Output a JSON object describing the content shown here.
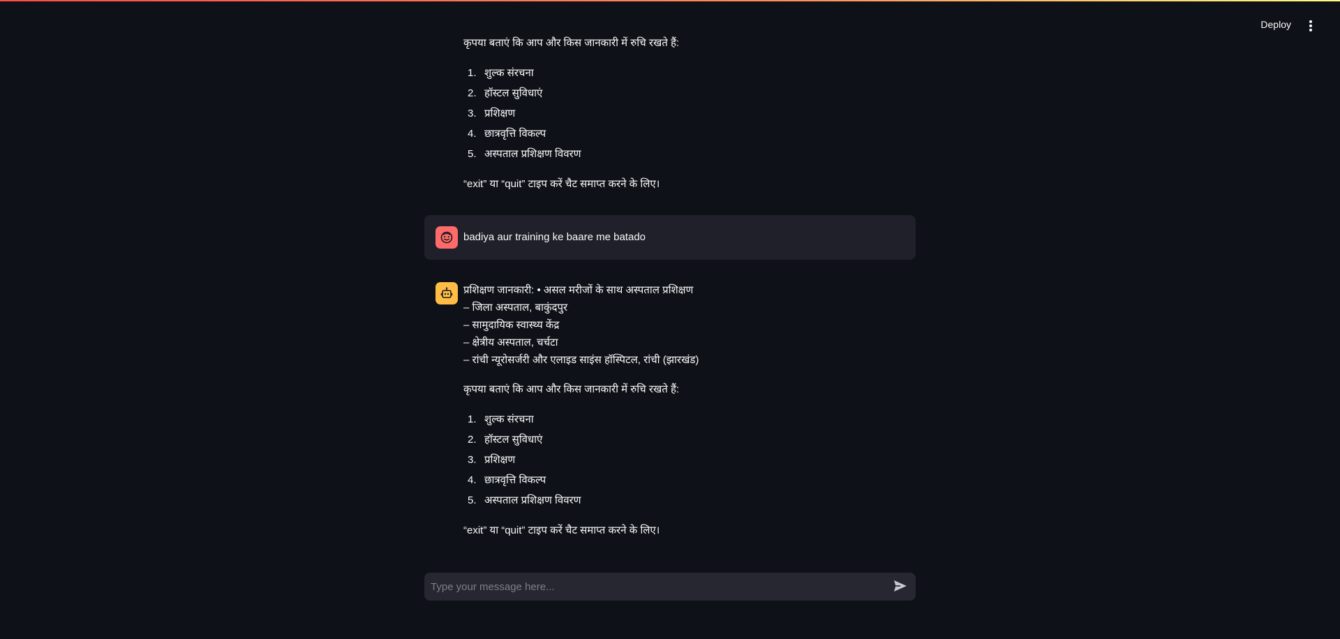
{
  "header": {
    "deploy_label": "Deploy",
    "menu_icon": "more-vertical-icon"
  },
  "messages": {
    "bot_prev": {
      "avatar_icon": "robot-icon",
      "prompt": "कृपया बताएं कि आप और किस जानकारी में रुचि रखते हैं:",
      "options": [
        "शुल्क संरचना",
        "हॉस्टल सुविधाएं",
        "प्रशिक्षण",
        "छात्रवृत्ति विकल्प",
        "अस्पताल प्रशिक्षण विवरण"
      ],
      "footer": "“exit” या “quit” टाइप करें चैट समाप्त करने के लिए।"
    },
    "user": {
      "avatar_icon": "user-face-icon",
      "text": "badiya aur training ke baare me batado"
    },
    "bot": {
      "avatar_icon": "robot-icon",
      "lines": [
        "प्रशिक्षण जानकारी: • असल मरीजों के साथ अस्पताल प्रशिक्षण",
        "– जिला अस्पताल, बाकुंदपुर",
        "– सामुदायिक स्वास्थ्य केंद्र",
        "– क्षेत्रीय अस्पताल, चर्चटा",
        "– रांची न्यूरोसर्जरी और एलाइड साइंस हॉस्पिटल, रांची (झारखंड)"
      ],
      "prompt": "कृपया बताएं कि आप और किस जानकारी में रुचि रखते हैं:",
      "options": [
        "शुल्क संरचना",
        "हॉस्टल सुविधाएं",
        "प्रशिक्षण",
        "छात्रवृत्ति विकल्प",
        "अस्पताल प्रशिक्षण विवरण"
      ],
      "footer": "“exit” या “quit” टाइप करें चैट समाप्त करने के लिए।"
    }
  },
  "chat_input": {
    "placeholder": "Type your message here...",
    "send_icon": "send-icon"
  },
  "colors": {
    "background": "#0e1117",
    "user_message_bg": "#1f2029",
    "input_bg": "#262730",
    "user_avatar": "#ff6b6b",
    "bot_avatar": "#ffbd45"
  }
}
